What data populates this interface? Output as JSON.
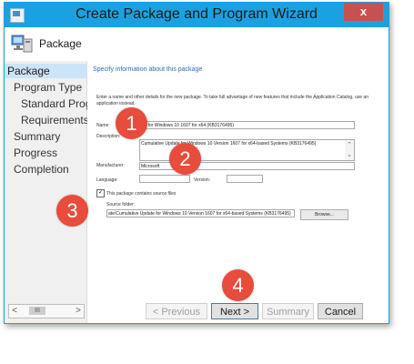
{
  "window": {
    "title": "Create Package and Program Wizard",
    "close_glyph": "x"
  },
  "header": {
    "title": "Package",
    "icon": "package-computer-icon"
  },
  "nav": {
    "items": [
      {
        "label": "Package",
        "active": true
      },
      {
        "label": "Program Type",
        "active": false
      },
      {
        "label": "Standard Program",
        "active": false
      },
      {
        "label": "Requirements",
        "active": false
      },
      {
        "label": "Summary",
        "active": false
      },
      {
        "label": "Progress",
        "active": false
      },
      {
        "label": "Completion",
        "active": false
      }
    ],
    "scroll_left": "<",
    "scroll_thumb": "III",
    "scroll_right": ">"
  },
  "content": {
    "section_title": "Specify information about this package",
    "help_text": "Enter a name and other details for the new package. To take full advantage of new features that include the Application Catalog, use an application instead.",
    "name_label": "Name:",
    "name_value": "ws for Windows 10 1607 for x64 (KB3176495)",
    "description_label": "Description:",
    "description_value": "Cumulative Update for Windows 10 Version 1607 for x64-based Systems (KB3176495)",
    "manufacturer_label": "Manufacturer:",
    "manufacturer_value": "Microsoft",
    "language_label": "Language:",
    "version_label": "Version:",
    "source_checkbox_label": "This package contains source files",
    "source_checked_glyph": "✓",
    "source_folder_label": "Source folder:",
    "source_folder_value": "ate\\Cumulative Update for Windows 10 Version 1607 for x64-based Systems (KB3176495)",
    "browse_label": "Browse..."
  },
  "footer": {
    "previous_label": "< Previous",
    "next_label": "Next >",
    "summary_label": "Summary",
    "cancel_label": "Cancel"
  },
  "badges": [
    "1",
    "2",
    "3",
    "4"
  ],
  "colors": {
    "titlebar": "#1ba1e2",
    "badge": "#e74c3c",
    "nav_active": "#cce4f7",
    "close": "#c75050"
  }
}
